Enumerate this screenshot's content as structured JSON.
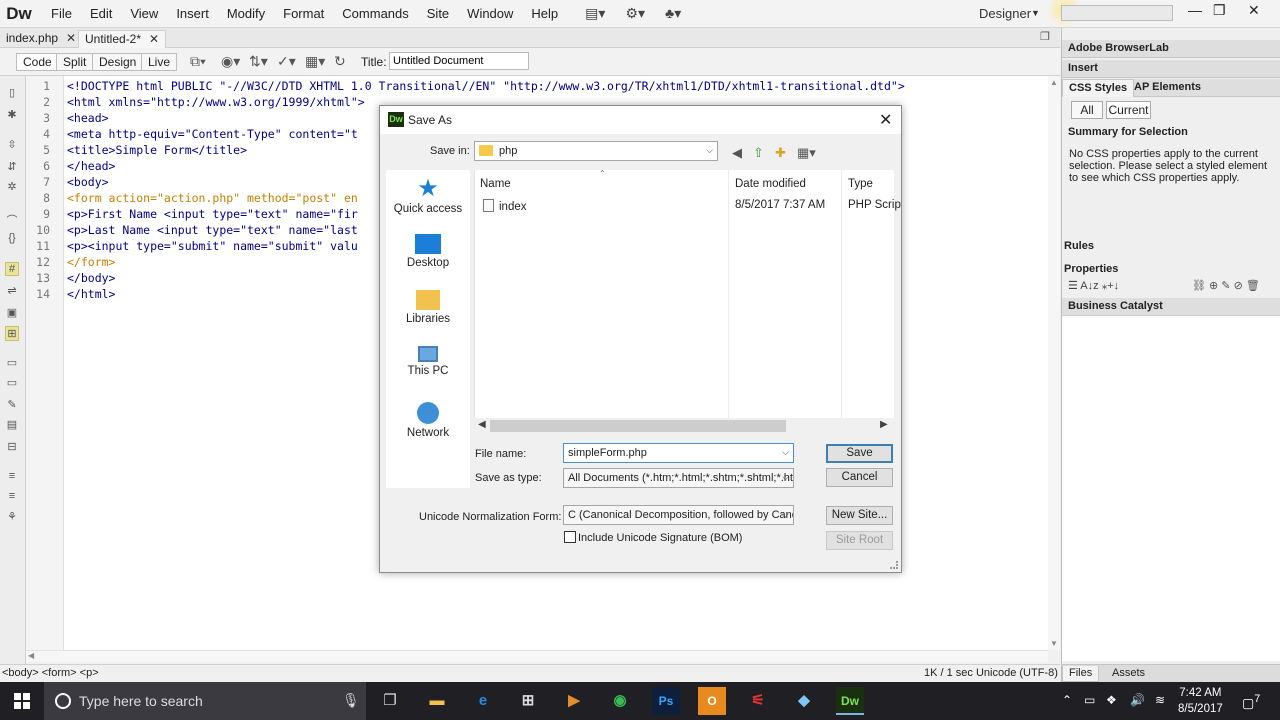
{
  "app": {
    "logo": "Dw",
    "menu": [
      "File",
      "Edit",
      "View",
      "Insert",
      "Modify",
      "Format",
      "Commands",
      "Site",
      "Window",
      "Help"
    ],
    "workspace": "Designer",
    "window_controls": {
      "minimize": "—",
      "restore": "❐",
      "close": "✕"
    }
  },
  "doc_tabs": [
    {
      "label": "index.php",
      "close": "✕"
    },
    {
      "label": "Untitled-2*",
      "close": "✕"
    }
  ],
  "toolbar": {
    "views": [
      "Code",
      "Split",
      "Design",
      "Live"
    ],
    "title_label": "Title:",
    "title_value": "Untitled Document"
  },
  "code": {
    "line_numbers": [
      "1",
      "2",
      "3",
      "4",
      "5",
      "6",
      "7",
      "8",
      "9",
      "10",
      "11",
      "12",
      "13",
      "14"
    ],
    "lines": [
      "<!DOCTYPE html PUBLIC \"-//W3C//DTD XHTML 1.0 Transitional//EN\" \"http://www.w3.org/TR/xhtml1/DTD/xhtml1-transitional.dtd\">",
      "<html xmlns=\"http://www.w3.org/1999/xhtml\">",
      "<head>",
      "<meta http-equiv=\"Content-Type\" content=\"t",
      "<title>Simple Form</title>",
      "</head>",
      "<body>",
      "<form action=\"action.php\" method=\"post\" en",
      "<p>First Name <input type=\"text\" name=\"fir",
      "<p>Last Name <input type=\"text\" name=\"last",
      "<p><input type=\"submit\" name=\"submit\" valu",
      "</form>",
      "</body>",
      "</html>"
    ]
  },
  "statusbar": {
    "tag_selector": "<body> <form> <p>",
    "right": "1K / 1 sec  Unicode (UTF-8)"
  },
  "panels": {
    "browserlab": "Adobe BrowserLab",
    "insert": "Insert",
    "css_tabs": [
      "CSS Styles",
      "AP Elements"
    ],
    "segments": [
      "All",
      "Current"
    ],
    "summary_title": "Summary for Selection",
    "summary_text": "No CSS properties apply to the current selection.  Please select a styled element to see which CSS properties apply.",
    "rules": "Rules",
    "properties": "Properties",
    "business_catalyst": "Business Catalyst",
    "bottom_tabs": [
      "Files",
      "Assets"
    ]
  },
  "dialog": {
    "title": "Save As",
    "save_in_label": "Save in:",
    "save_in_value": "php",
    "places": [
      "Quick access",
      "Desktop",
      "Libraries",
      "This PC",
      "Network"
    ],
    "columns": [
      "Name",
      "Date modified",
      "Type"
    ],
    "files": [
      {
        "name": "index",
        "date": "8/5/2017 7:37 AM",
        "type": "PHP Scrip"
      }
    ],
    "file_name_label": "File name:",
    "file_name_value": "simpleForm.php",
    "save_type_label": "Save as type:",
    "save_type_value": "All Documents (*.htm;*.html;*.shtm;*.shtml;*.hta;",
    "unicode_label": "Unicode Normalization Form:",
    "unicode_value": "C (Canonical Decomposition, followed by Canc",
    "bom_label": "Include Unicode Signature (BOM)",
    "bom_checked": false,
    "buttons": {
      "save": "Save",
      "cancel": "Cancel",
      "new_site": "New Site...",
      "site_root": "Site Root"
    }
  },
  "taskbar": {
    "search_placeholder": "Type here to search",
    "time": "7:42 AM",
    "date": "8/5/2017",
    "notifications": "7"
  }
}
